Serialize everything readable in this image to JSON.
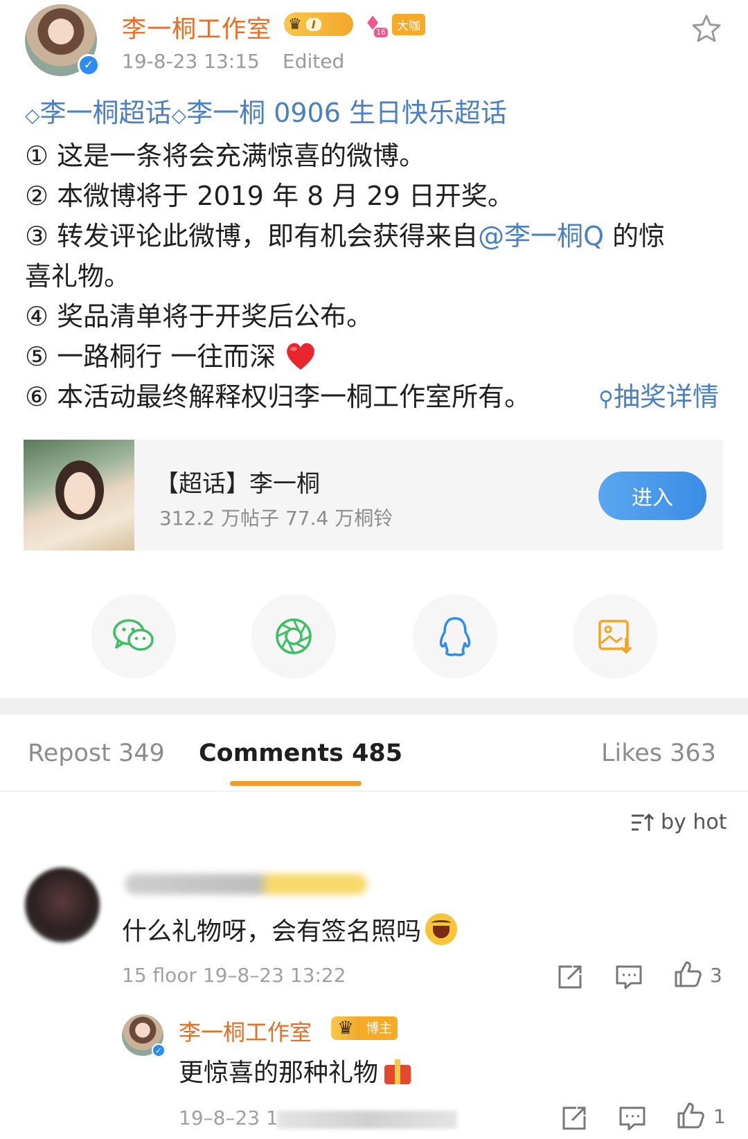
{
  "post": {
    "author": "李一桐工作室",
    "badge_level": "I",
    "badge_gem_number": "16",
    "badge_vip": "大咖",
    "time": "19-8-23 13:15",
    "edited": "Edited",
    "topic_1": "李一桐超话",
    "topic_2": "李一桐 0906 生日快乐超话",
    "lines": [
      "① 这是一条将会充满惊喜的微博。",
      "② 本微博将于 2019 年 8 月 29 日开奖。",
      "③ 转发评论此微博，即有机会获得来自",
      "喜礼物。",
      "④ 奖品清单将于开奖后公布。",
      "⑤ 一路桐行 一往而深",
      "⑥ 本活动最终解释权归李一桐工作室所有。"
    ],
    "mention": "@李一桐Q",
    "mention_after": " 的惊",
    "lottery_link": "抽奖详情"
  },
  "card": {
    "title": "【超话】李一桐",
    "subtitle": "312.2 万帖子 77.4 万桐铃",
    "enter_label": "进入"
  },
  "share": {
    "icons": [
      "wechat-icon",
      "moments-icon",
      "qq-icon",
      "save-image-icon"
    ],
    "colors": {
      "wechat": "#3fbf64",
      "moments": "#3fbf64",
      "qq": "#2d8cf0",
      "save": "#f2a521"
    }
  },
  "tabs": {
    "repost": "Repost 349",
    "comments": "Comments 485",
    "likes": "Likes 363",
    "sort": "by hot",
    "accent": "#f39a2b"
  },
  "comment": {
    "text": "什么礼物呀，会有签名照吗",
    "meta": "15 floor 19–8–23 13:22",
    "likes": "3"
  },
  "reply": {
    "author": "李一桐工作室",
    "host_badge": "博主",
    "text": "更惊喜的那种礼物",
    "meta": "19–8–23 1",
    "likes": "1"
  }
}
